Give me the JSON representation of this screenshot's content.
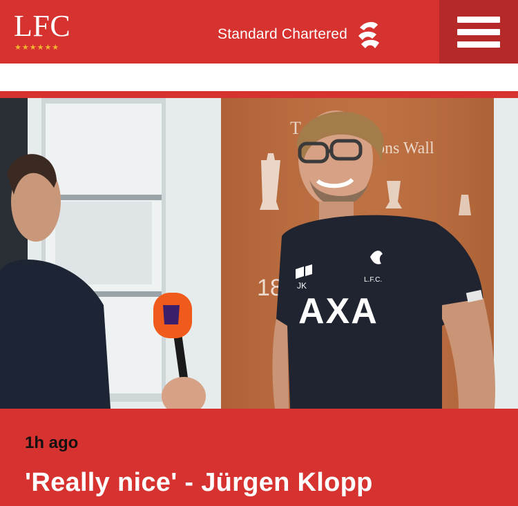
{
  "header": {
    "logo": "LFC",
    "logo_stars": "★★★★★★",
    "sponsor": "Standard Chartered",
    "sponsor_icon": "standard-chartered-logo-icon",
    "menu_icon": "hamburger-menu-icon"
  },
  "colors": {
    "brand_red": "#d6322f",
    "menu_red": "#b52a28",
    "star_gold": "#f2b632"
  },
  "article": {
    "image_description_icon": "photo",
    "shirt_sponsor": "AXA",
    "shirt_club": "L.F.C.",
    "shirt_initials": "JK",
    "time": "1h ago",
    "headline": "'Really nice' - Jürgen Klopp"
  }
}
